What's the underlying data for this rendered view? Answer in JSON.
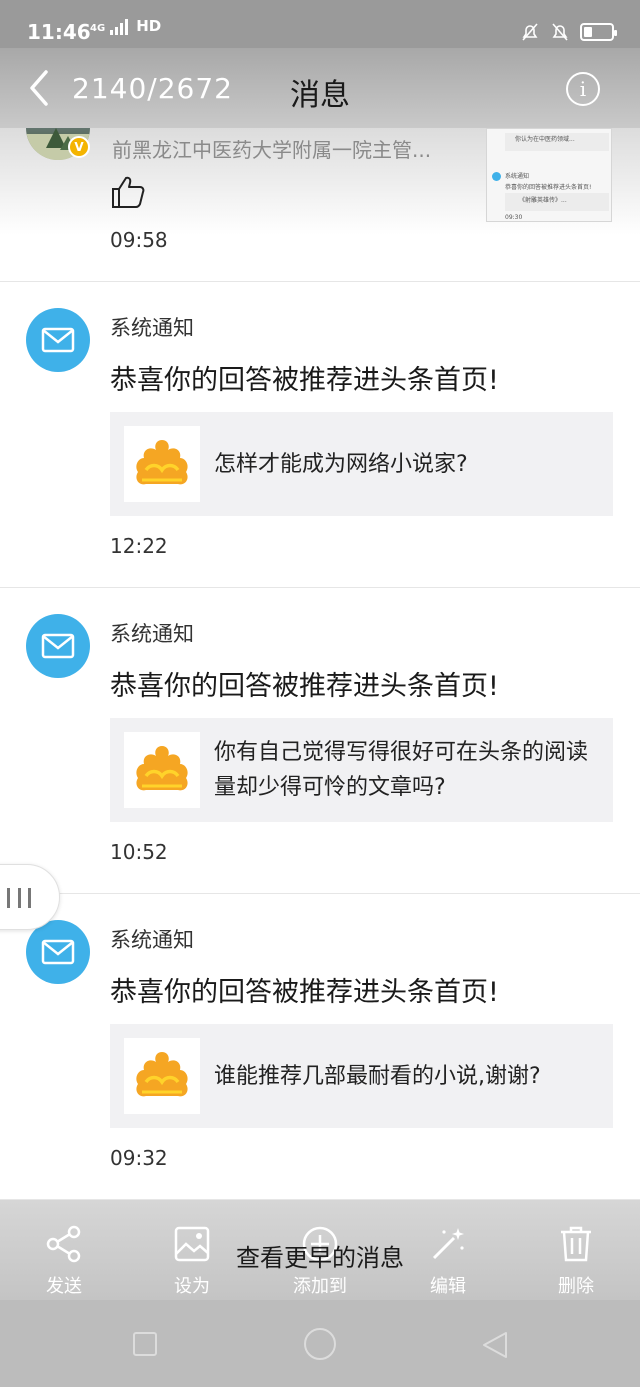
{
  "status_bar": {
    "time": "11:46",
    "network": "4G",
    "hd": "HD",
    "battery_level": 0.3
  },
  "header": {
    "counter": "2140/2672",
    "title": "消息",
    "info_glyph": "i"
  },
  "partial_message": {
    "name": "前黑龙江中医药大学附属一院主管...",
    "badge": "V",
    "time": "09:58",
    "thumbnail_text": [
      "你认为在中医药领域...",
      "系统通知",
      "恭喜你的回答被推荐进头条首页!",
      "《射雕英雄传》...",
      "09:30"
    ]
  },
  "notifications": [
    {
      "sender": "系统通知",
      "headline": "恭喜你的回答被推荐进头条首页!",
      "question": "怎样才能成为网络小说家?",
      "time": "12:22"
    },
    {
      "sender": "系统通知",
      "headline": "恭喜你的回答被推荐进头条首页!",
      "question": "你有自己觉得写得很好可在头条的阅读量却少得可怜的文章吗?",
      "time": "10:52"
    },
    {
      "sender": "系统通知",
      "headline": "恭喜你的回答被推荐进头条首页!",
      "question": "谁能推荐几部最耐看的小说,谢谢?",
      "time": "09:32"
    }
  ],
  "toolbar": {
    "more_messages": "查看更早的消息",
    "share": "发送",
    "set_as": "设为",
    "add_to": "添加到",
    "edit": "编辑",
    "delete": "删除"
  },
  "colors": {
    "mail_icon_bg": "#3fb1e9",
    "card_bg": "#f1f1f3",
    "logo_orange": "#f5a623",
    "logo_yellow": "#ffd32a"
  }
}
